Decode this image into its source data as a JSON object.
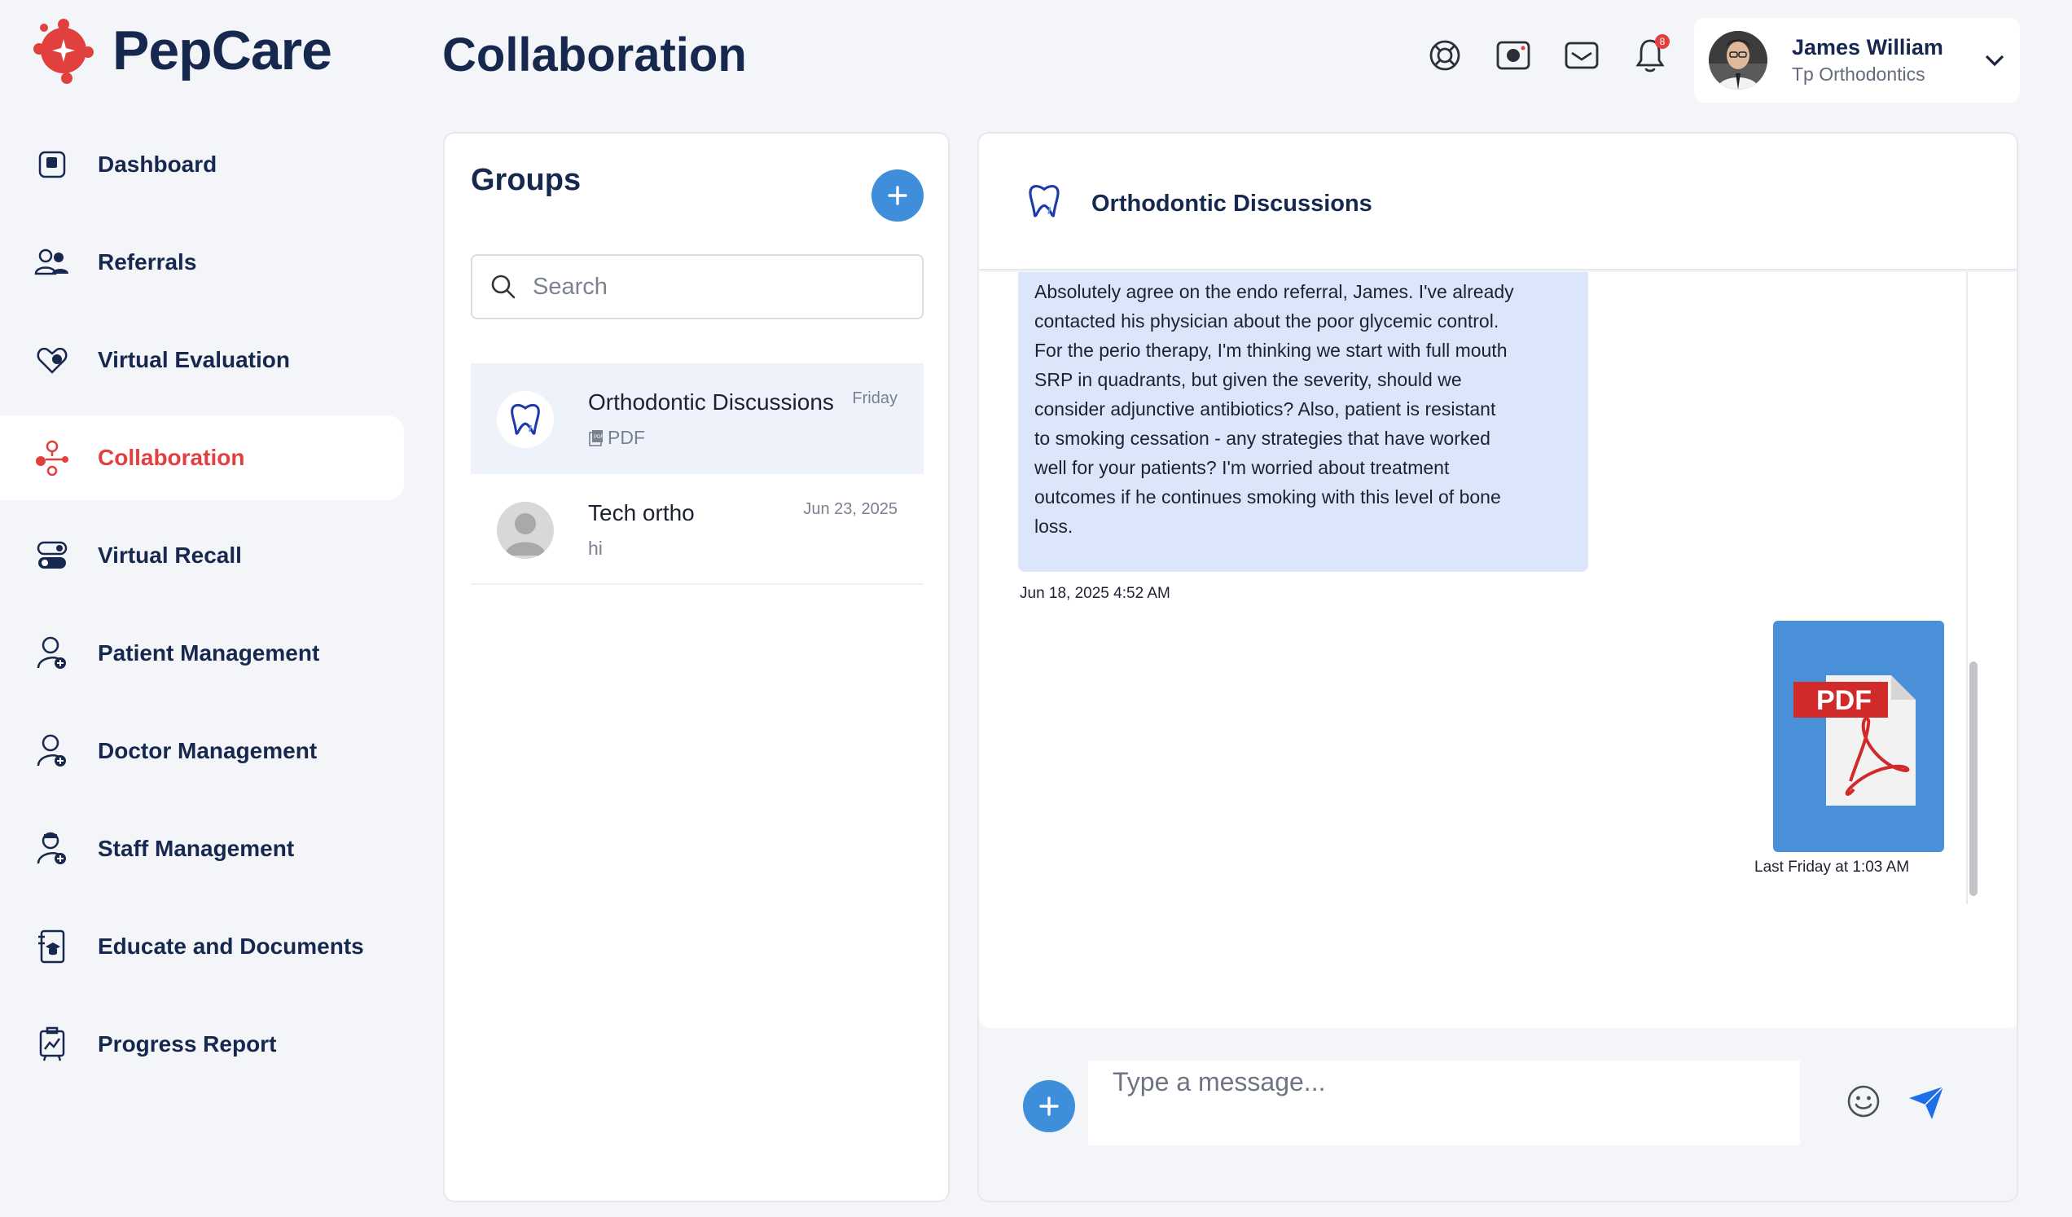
{
  "brand": {
    "name": "PepCare",
    "accent": "#e2403f",
    "primary": "#17284f",
    "button_blue": "#3e8edc"
  },
  "page": {
    "title": "Collaboration"
  },
  "header": {
    "icons": [
      "support-icon",
      "camera-icon",
      "mail-icon",
      "bell-icon"
    ],
    "notification_count": "8",
    "user": {
      "name": "James William",
      "org": "Tp Orthodontics"
    }
  },
  "sidebar": {
    "items": [
      {
        "label": "Dashboard",
        "icon": "dashboard-icon"
      },
      {
        "label": "Referrals",
        "icon": "referrals-icon"
      },
      {
        "label": "Virtual Evaluation",
        "icon": "heart-icon"
      },
      {
        "label": "Collaboration",
        "icon": "collaboration-icon",
        "active": true
      },
      {
        "label": "Virtual Recall",
        "icon": "recall-icon"
      },
      {
        "label": "Patient Management",
        "icon": "patient-icon"
      },
      {
        "label": "Doctor Management",
        "icon": "doctor-icon"
      },
      {
        "label": "Staff Management",
        "icon": "staff-icon"
      },
      {
        "label": "Educate and Documents",
        "icon": "education-icon"
      },
      {
        "label": "Progress Report",
        "icon": "report-icon"
      }
    ]
  },
  "groups": {
    "title": "Groups",
    "search_placeholder": "Search",
    "list": [
      {
        "name": "Orthodontic Discussions",
        "date": "Friday",
        "preview": "PDF",
        "active": true
      },
      {
        "name": "Tech ortho",
        "date": "Jun 23, 2025",
        "preview": "hi"
      }
    ]
  },
  "chat": {
    "title": "Orthodontic Discussions",
    "messages": [
      {
        "lines": [
          "Absolutely agree on the endo referral, James. I've already",
          "contacted his physician about the poor glycemic control.",
          "For the perio therapy, I'm thinking we start with full mouth",
          "SRP in quadrants, but given the severity, should we",
          "consider adjunctive antibiotics? Also, patient is resistant",
          "to smoking cessation - any strategies that have worked",
          "well for your patients? I'm worried about treatment",
          "outcomes if he continues smoking with this level of bone",
          "loss."
        ],
        "time": "Jun 18, 2025 4:52 AM"
      },
      {
        "attachment": "PDF",
        "time": "Last Friday at 1:03 AM"
      }
    ],
    "composer_placeholder": "Type a message..."
  }
}
